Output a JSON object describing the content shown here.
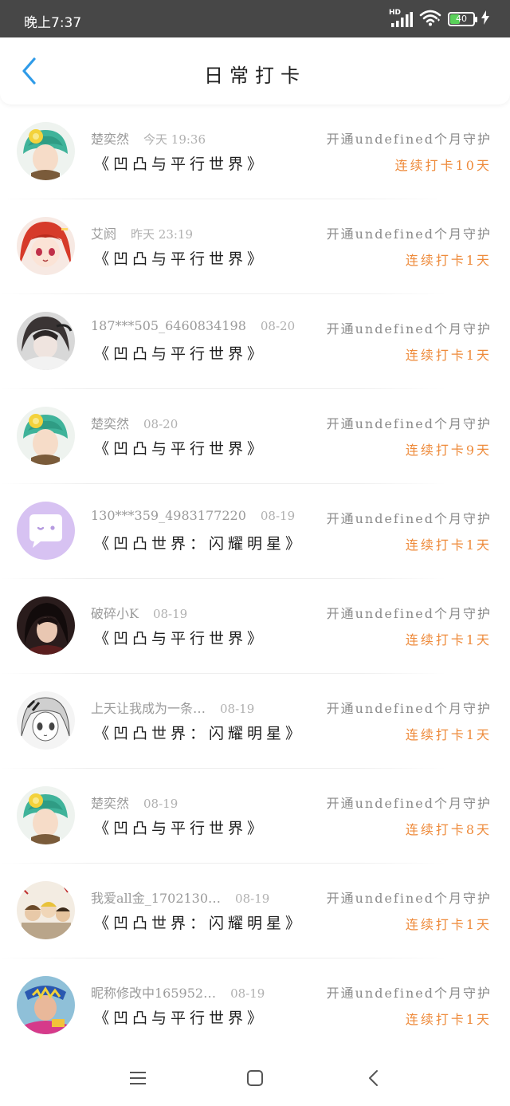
{
  "status_bar": {
    "time": "晚上7:37",
    "network_label": "HD",
    "battery_text": "40",
    "battery_level": 0.4
  },
  "header": {
    "title": "日常打卡",
    "back_icon": "back-arrow-icon"
  },
  "rows": [
    {
      "name": "楚奕然",
      "time": "今天 19:36",
      "book": "《凹凸与平行世界》",
      "guard": "开通undefined个月守护",
      "streak": "连续打卡10天",
      "avatar": "avatar-green-hair"
    },
    {
      "name": "艾阏",
      "time": "昨天 23:19",
      "book": "《凹凸与平行世界》",
      "guard": "开通undefined个月守护",
      "streak": "连续打卡1天",
      "avatar": "avatar-red-hair"
    },
    {
      "name": "187***505_6460834198",
      "time": "08-20",
      "book": "《凹凸与平行世界》",
      "guard": "开通undefined个月守护",
      "streak": "连续打卡1天",
      "avatar": "avatar-dark-hair"
    },
    {
      "name": "楚奕然",
      "time": "08-20",
      "book": "《凹凸与平行世界》",
      "guard": "开通undefined个月守护",
      "streak": "连续打卡9天",
      "avatar": "avatar-green-hair"
    },
    {
      "name": "130***359_4983177220",
      "time": "08-19",
      "book": "《凹凸世界：闪耀明星》",
      "guard": "开通undefined个月守护",
      "streak": "连续打卡1天",
      "avatar": "avatar-default-chat"
    },
    {
      "name": "破碎小K",
      "time": "08-19",
      "book": "《凹凸与平行世界》",
      "guard": "开通undefined个月守护",
      "streak": "连续打卡1天",
      "avatar": "avatar-dark-portrait"
    },
    {
      "name": "上天让我成为一条…",
      "time": "08-19",
      "book": "《凹凸世界：闪耀明星》",
      "guard": "开通undefined个月守护",
      "streak": "连续打卡1天",
      "avatar": "avatar-sketch"
    },
    {
      "name": "楚奕然",
      "time": "08-19",
      "book": "《凹凸与平行世界》",
      "guard": "开通undefined个月守护",
      "streak": "连续打卡8天",
      "avatar": "avatar-green-hair"
    },
    {
      "name": "我爱all金_1702130…",
      "time": "08-19",
      "book": "《凹凸世界：闪耀明星》",
      "guard": "开通undefined个月守护",
      "streak": "连续打卡1天",
      "avatar": "avatar-group-photo"
    },
    {
      "name": "昵称修改中165952…",
      "time": "08-19",
      "book": "《凹凸与平行世界》",
      "guard": "开通undefined个月守护",
      "streak": "连续打卡1天",
      "avatar": "avatar-colorful"
    }
  ],
  "navbar": {
    "menu_icon": "menu-icon",
    "home_icon": "home-square-icon",
    "back_icon": "back-triangle-icon"
  },
  "colors": {
    "accent_blue": "#2f9be8",
    "streak_orange": "#ee8a3a",
    "status_bar_bg": "#474747"
  }
}
